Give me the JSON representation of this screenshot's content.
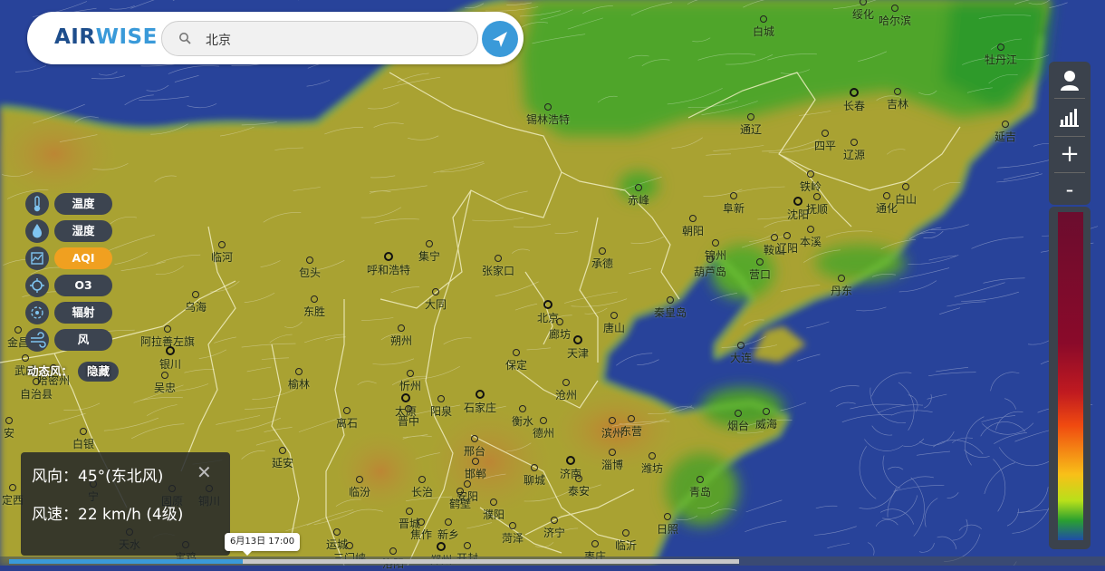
{
  "header": {
    "logo_part1": "AIR",
    "logo_part2": "WISE",
    "search_value": "北京"
  },
  "layers": [
    {
      "label": "温度",
      "icon": "thermometer-icon",
      "active": false
    },
    {
      "label": "湿度",
      "icon": "droplet-icon",
      "active": false
    },
    {
      "label": "AQI",
      "icon": "aqi-chart-icon",
      "active": true
    },
    {
      "label": "O3",
      "icon": "ozone-icon",
      "active": false
    },
    {
      "label": "辐射",
      "icon": "radiation-icon",
      "active": false
    },
    {
      "label": "风",
      "icon": "wind-icon",
      "active": false
    }
  ],
  "dynamic_wind": {
    "label": "动态风：",
    "toggle": "隐藏"
  },
  "wind_info": {
    "direction": "风向：45°(东北风)",
    "speed": "风速：22 km/h (4级)"
  },
  "timeline": {
    "time_label": "6月13日  17:00",
    "progress": 0.32
  },
  "right_controls": {
    "zoom_in": "+",
    "zoom_out": "-"
  },
  "colors": {
    "accent": "#3a9ad9",
    "active_layer": "#f0a020",
    "panel": "#3c4450"
  },
  "cities": [
    {
      "name": "哈尔滨",
      "capital": false
    },
    {
      "name": "绥化",
      "capital": false
    },
    {
      "name": "牡丹江",
      "capital": false
    },
    {
      "name": "白城",
      "capital": false
    },
    {
      "name": "锡林浩特",
      "capital": false
    },
    {
      "name": "长春",
      "capital": true
    },
    {
      "name": "吉林",
      "capital": false
    },
    {
      "name": "通辽",
      "capital": false
    },
    {
      "name": "四平",
      "capital": false
    },
    {
      "name": "辽源",
      "capital": false
    },
    {
      "name": "延吉",
      "capital": false
    },
    {
      "name": "铁岭",
      "capital": false
    },
    {
      "name": "赤峰",
      "capital": false
    },
    {
      "name": "阜新",
      "capital": false
    },
    {
      "name": "沈阳",
      "capital": true
    },
    {
      "name": "抚顺",
      "capital": false
    },
    {
      "name": "通化",
      "capital": false
    },
    {
      "name": "白山",
      "capital": false
    },
    {
      "name": "朝阳",
      "capital": false
    },
    {
      "name": "锦州",
      "capital": false
    },
    {
      "name": "鞍山",
      "capital": false
    },
    {
      "name": "本溪",
      "capital": false
    },
    {
      "name": "辽阳",
      "capital": false
    },
    {
      "name": "营口",
      "capital": false
    },
    {
      "name": "葫芦岛",
      "capital": false
    },
    {
      "name": "丹东",
      "capital": false
    },
    {
      "name": "承德",
      "capital": false
    },
    {
      "name": "张家口",
      "capital": false
    },
    {
      "name": "集宁",
      "capital": false
    },
    {
      "name": "呼和浩特",
      "capital": true
    },
    {
      "name": "包头",
      "capital": false
    },
    {
      "name": "临河",
      "capital": false
    },
    {
      "name": "乌海",
      "capital": false
    },
    {
      "name": "阿拉善左旗",
      "capital": false
    },
    {
      "name": "金昌",
      "capital": false
    },
    {
      "name": "武威",
      "capital": false
    },
    {
      "name": "银川",
      "capital": true
    },
    {
      "name": "吴忠",
      "capital": false
    },
    {
      "name": "东胜",
      "capital": false
    },
    {
      "name": "大同",
      "capital": false
    },
    {
      "name": "朔州",
      "capital": false
    },
    {
      "name": "北京",
      "capital": true
    },
    {
      "name": "廊坊",
      "capital": false
    },
    {
      "name": "唐山",
      "capital": false
    },
    {
      "name": "秦皇岛",
      "capital": false
    },
    {
      "name": "天津",
      "capital": true
    },
    {
      "name": "保定",
      "capital": false
    },
    {
      "name": "沧州",
      "capital": false
    },
    {
      "name": "大连",
      "capital": false
    },
    {
      "name": "忻州",
      "capital": false
    },
    {
      "name": "榆林",
      "capital": false
    },
    {
      "name": "太原",
      "capital": true
    },
    {
      "name": "阳泉",
      "capital": false
    },
    {
      "name": "石家庄",
      "capital": true
    },
    {
      "name": "晋中",
      "capital": false
    },
    {
      "name": "衡水",
      "capital": false
    },
    {
      "name": "德州",
      "capital": false
    },
    {
      "name": "滨州",
      "capital": false
    },
    {
      "name": "东营",
      "capital": false
    },
    {
      "name": "烟台",
      "capital": false
    },
    {
      "name": "威海",
      "capital": false
    },
    {
      "name": "离石",
      "capital": false
    },
    {
      "name": "邢台",
      "capital": false
    },
    {
      "name": "邯郸",
      "capital": false
    },
    {
      "name": "济南",
      "capital": true
    },
    {
      "name": "淄博",
      "capital": false
    },
    {
      "name": "潍坊",
      "capital": false
    },
    {
      "name": "青岛",
      "capital": false
    },
    {
      "name": "白银",
      "capital": false
    },
    {
      "name": "延安",
      "capital": false
    },
    {
      "name": "临汾",
      "capital": false
    },
    {
      "name": "长治",
      "capital": false
    },
    {
      "name": "安阳",
      "capital": false
    },
    {
      "name": "聊城",
      "capital": false
    },
    {
      "name": "泰安",
      "capital": false
    },
    {
      "name": "鹤壁",
      "capital": false
    },
    {
      "name": "濮阳",
      "capital": false
    },
    {
      "name": "定西",
      "capital": false
    },
    {
      "name": "固原",
      "capital": false
    },
    {
      "name": "铜川",
      "capital": false
    },
    {
      "name": "晋城",
      "capital": false
    },
    {
      "name": "焦作",
      "capital": false
    },
    {
      "name": "新乡",
      "capital": false
    },
    {
      "name": "运城",
      "capital": false
    },
    {
      "name": "菏泽",
      "capital": false
    },
    {
      "name": "济宁",
      "capital": false
    },
    {
      "name": "临沂",
      "capital": false
    },
    {
      "name": "日照",
      "capital": false
    },
    {
      "name": "天水",
      "capital": false
    },
    {
      "name": "宝鸡",
      "capital": false
    },
    {
      "name": "三门峡",
      "capital": false
    },
    {
      "name": "洛阳",
      "capital": false
    },
    {
      "name": "郑州",
      "capital": true
    },
    {
      "name": "开封",
      "capital": false
    },
    {
      "name": "枣庄",
      "capital": false
    },
    {
      "name": "哈密州",
      "capital": false
    },
    {
      "name": "自治县",
      "capital": false
    },
    {
      "name": "安",
      "capital": false
    },
    {
      "name": "宁",
      "capital": false
    }
  ]
}
